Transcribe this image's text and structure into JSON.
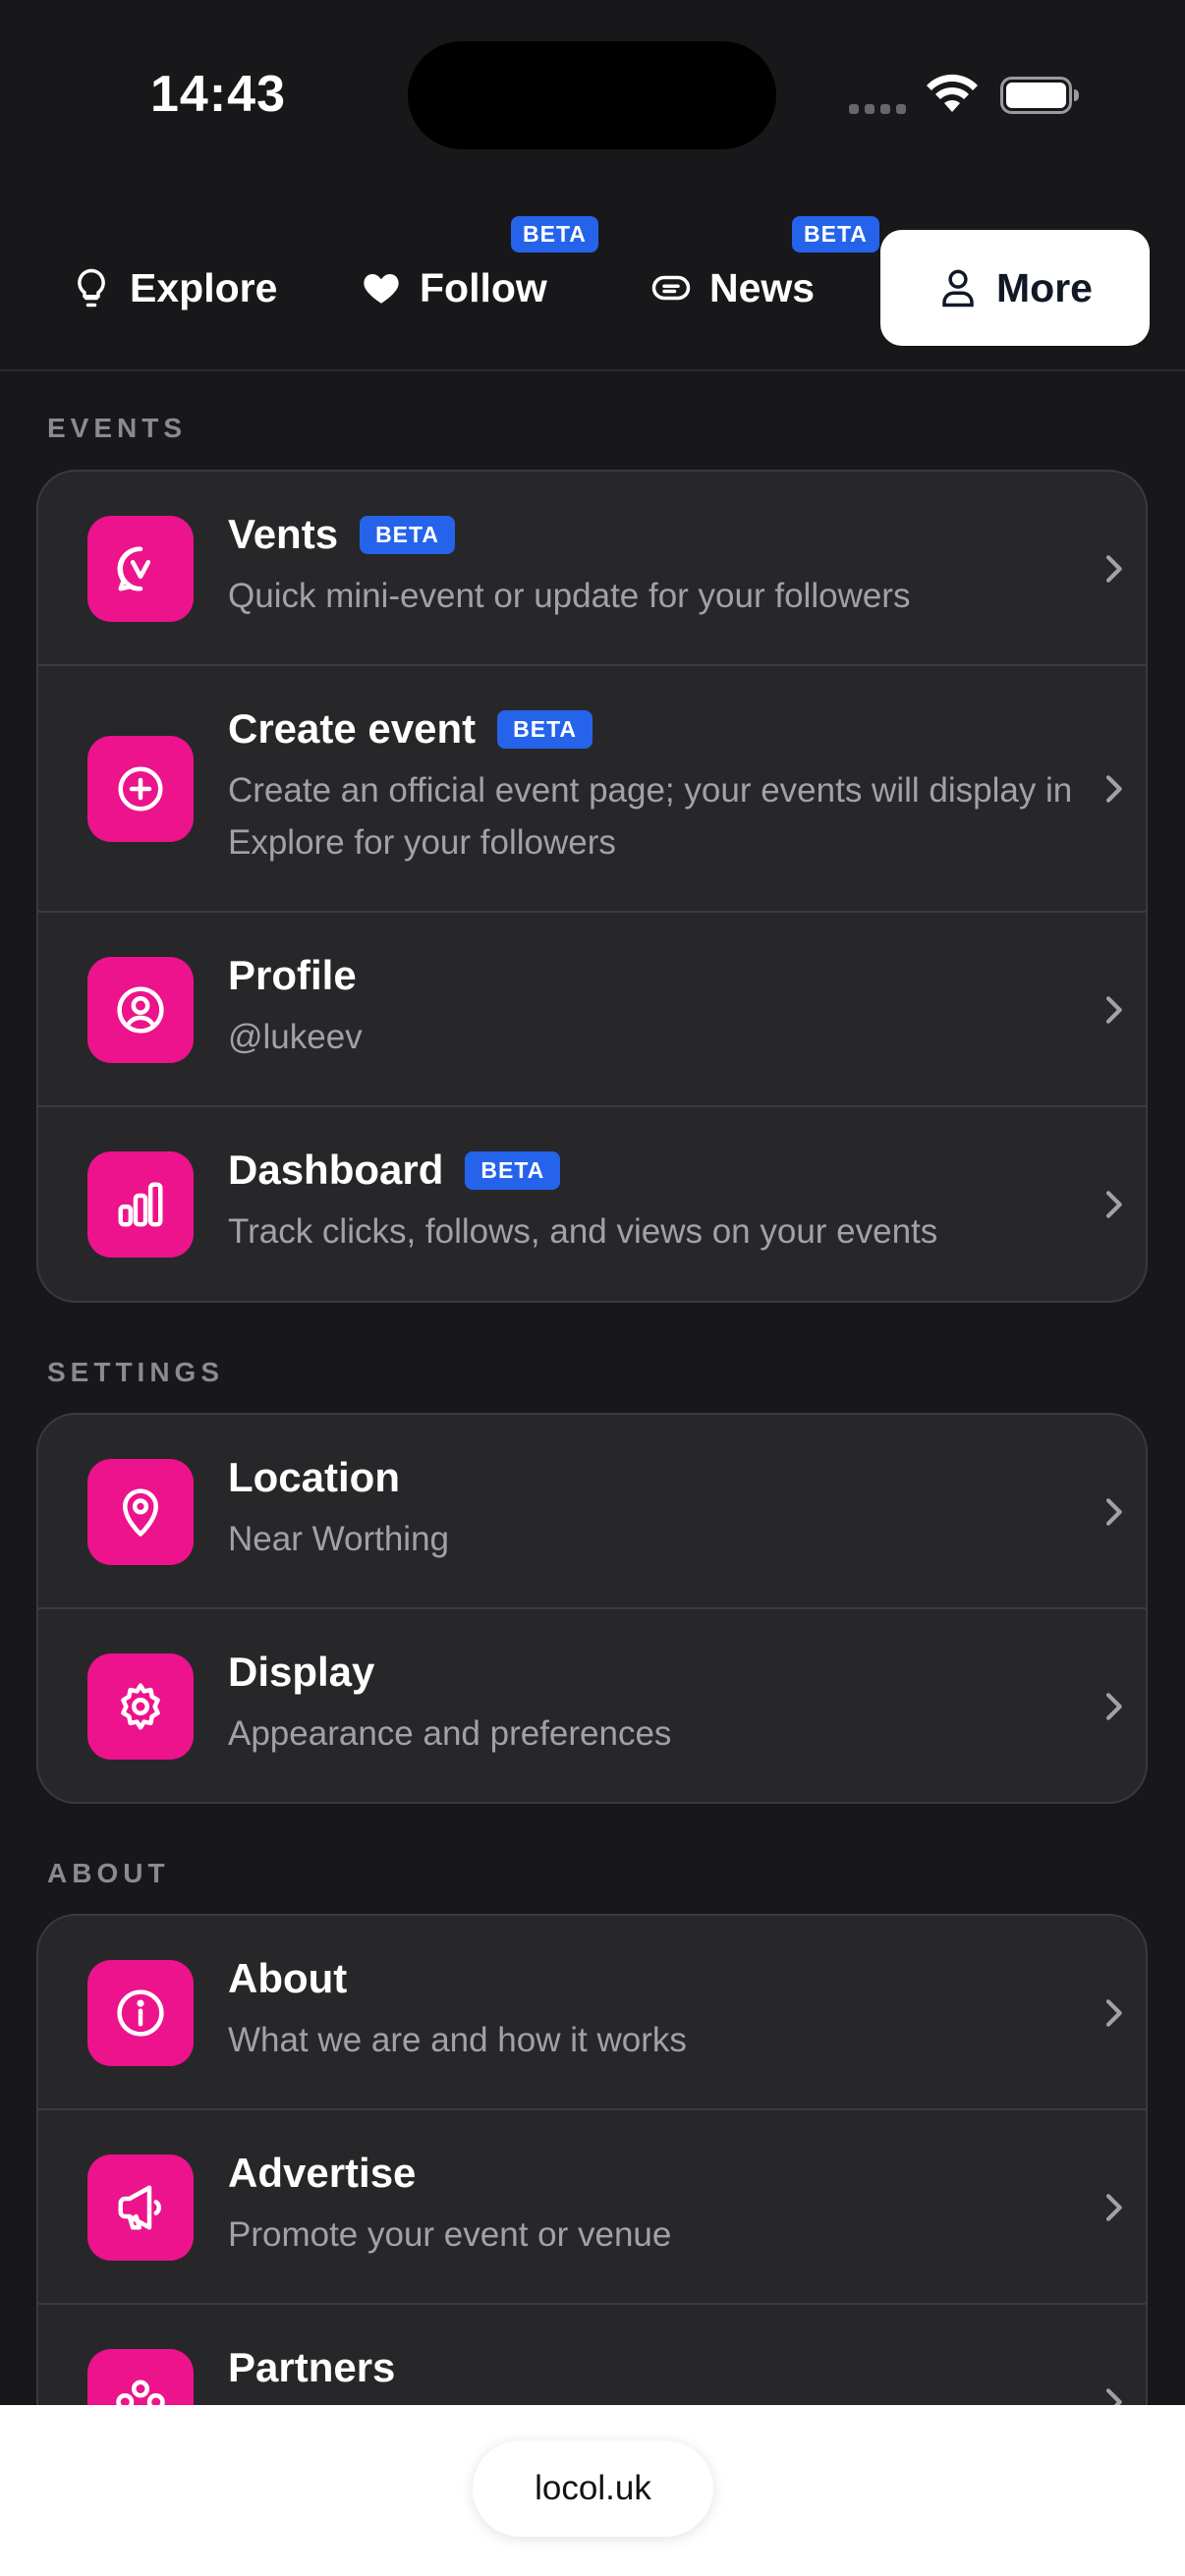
{
  "status": {
    "time": "14:43"
  },
  "tabs": [
    {
      "label": "Explore",
      "icon": "lightbulb-icon"
    },
    {
      "label": "Follow",
      "icon": "heart-icon",
      "badge": "BETA"
    },
    {
      "label": "News",
      "icon": "news-icon",
      "badge": "BETA"
    },
    {
      "label": "More",
      "icon": "user-icon",
      "active": true
    }
  ],
  "sections": {
    "events": {
      "label": "EVENTS",
      "items": [
        {
          "title": "Vents",
          "badge": "BETA",
          "subtitle": "Quick mini-event or update for your followers",
          "icon": "vents-icon"
        },
        {
          "title": "Create event",
          "badge": "BETA",
          "subtitle": "Create an official event page; your events will display in Explore for your followers",
          "icon": "plus-circle-icon"
        },
        {
          "title": "Profile",
          "subtitle": "@lukeev",
          "icon": "profile-icon"
        },
        {
          "title": "Dashboard",
          "badge": "BETA",
          "subtitle": "Track clicks, follows, and views on your events",
          "icon": "bar-chart-icon"
        }
      ]
    },
    "settings": {
      "label": "SETTINGS",
      "items": [
        {
          "title": "Location",
          "subtitle": "Near Worthing",
          "icon": "map-pin-icon"
        },
        {
          "title": "Display",
          "subtitle": "Appearance and preferences",
          "icon": "gear-icon"
        }
      ]
    },
    "about": {
      "label": "ABOUT",
      "items": [
        {
          "title": "About",
          "subtitle": "What we are and how it works",
          "icon": "info-icon"
        },
        {
          "title": "Advertise",
          "subtitle": "Promote your event or venue",
          "icon": "megaphone-icon"
        },
        {
          "title": "Partners",
          "subtitle": "",
          "icon": "partners-icon"
        }
      ]
    }
  },
  "browser": {
    "url": "locol.uk"
  },
  "colors": {
    "accent": "#ec138c",
    "beta": "#2563eb",
    "background": "#18181b",
    "card": "#27272a"
  }
}
